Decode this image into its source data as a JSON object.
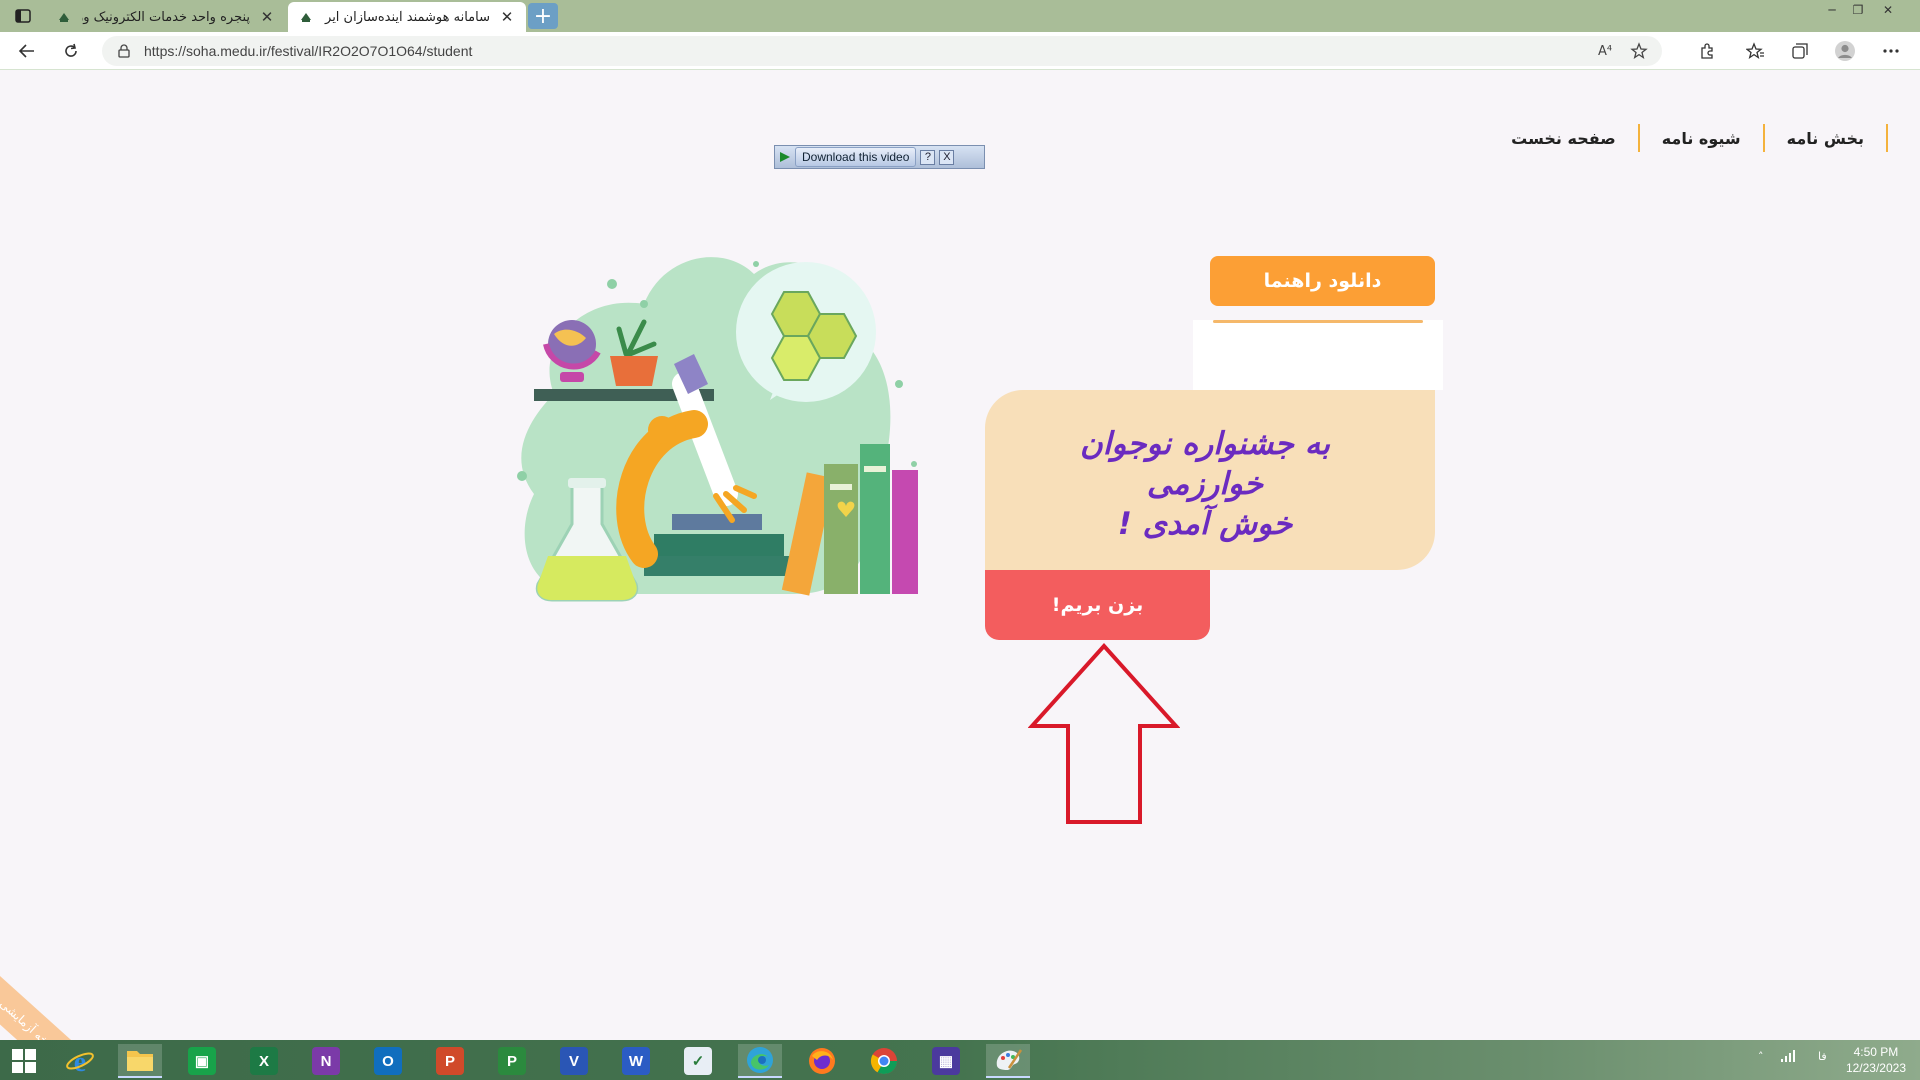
{
  "browser": {
    "tabs": [
      {
        "title": "پنجره واحد خدمات الکترونیک وزارت",
        "active": false
      },
      {
        "title": "سامانه هوشمند آینده‌سازان ایران",
        "active": true
      }
    ],
    "new_tab_label": "+",
    "url": "https://soha.medu.ir/festival/IR2O2O7O1O64/student",
    "read_aloud_label": "A⁴"
  },
  "page": {
    "nav": [
      {
        "label": "صفحه نخست"
      },
      {
        "label": "شیوه نامه"
      },
      {
        "label": "بخش نامه"
      }
    ],
    "download_video": {
      "label": "Download this video",
      "help": "?",
      "close": "X"
    },
    "guide_button": "دانلود راهنما",
    "welcome_line1": "به جشنواره نوجوان خوارزمی",
    "welcome_line2": "خوش آمدی !",
    "go_button": "بزن بریم!",
    "ribbon_text": "نسخه آزمایشی"
  },
  "colors": {
    "accent_orange": "#fc9f35",
    "card_bg": "#f8dfb9",
    "title_purple": "#6b2bc0",
    "go_red": "#f35d5e",
    "arrow_red": "#d9192a",
    "nav_separator": "#f4b23d"
  },
  "taskbar": {
    "apps": [
      "internet-explorer",
      "file-explorer",
      "store",
      "excel",
      "onenote",
      "outlook",
      "powerpoint",
      "project",
      "visio",
      "word",
      "checklist",
      "edge",
      "firefox",
      "chrome",
      "calendar",
      "paint"
    ],
    "language": "فا",
    "time": "4:50 PM",
    "date": "12/23/2023"
  }
}
